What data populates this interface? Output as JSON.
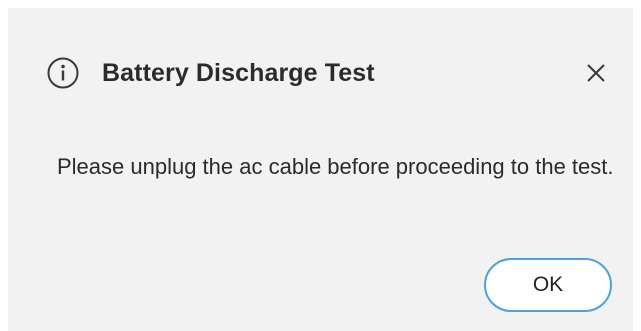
{
  "dialog": {
    "title": "Battery Discharge Test",
    "info_icon": "info-circle-icon",
    "close_icon": "close-x-icon",
    "message": "Please unplug the ac cable before proceeding to the test.",
    "ok_label": "OK",
    "colors": {
      "background": "#f2f2f2",
      "text": "#2b2b2b",
      "button_border": "#4aa3df",
      "button_background": "#ffffff"
    }
  }
}
